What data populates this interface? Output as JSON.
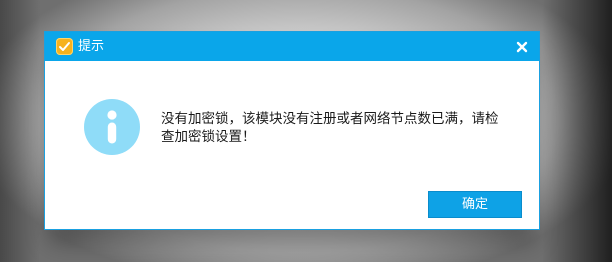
{
  "dialog": {
    "title": "提示",
    "message": "没有加密锁，该模块没有注册或者网络节点数已满，请检查加密锁设置！",
    "ok_label": "确定"
  },
  "icons": {
    "app": "app-logo-icon",
    "close": "close-icon",
    "info": "info-icon"
  },
  "colors": {
    "titlebar": "#0aa6ea",
    "button": "#0ea2e6",
    "info_icon": "#8fdcf8"
  }
}
